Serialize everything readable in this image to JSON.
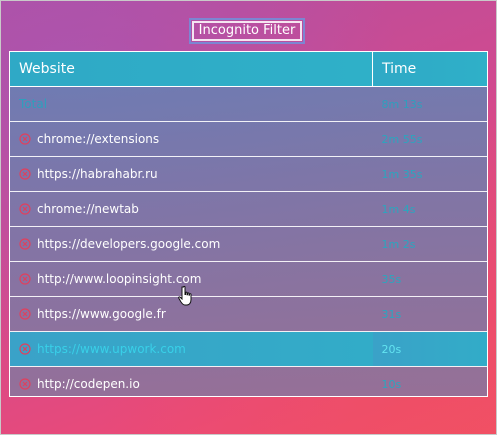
{
  "filter_button": {
    "label": "Incognito Filter"
  },
  "table": {
    "headers": {
      "website": "Website",
      "time": "Time"
    },
    "total": {
      "label": "Total",
      "time": "8m 13s"
    },
    "rows": [
      {
        "site": "chrome://extensions",
        "time": "2m 55s"
      },
      {
        "site": "https://habrahabr.ru",
        "time": "1m 35s"
      },
      {
        "site": "chrome://newtab",
        "time": "1m 4s"
      },
      {
        "site": "https://developers.google.com",
        "time": "1m 2s"
      },
      {
        "site": "http://www.loopinsight.com",
        "time": "35s"
      },
      {
        "site": "https://www.google.fr",
        "time": "31s"
      },
      {
        "site": "https://www.upwork.com",
        "time": "20s"
      },
      {
        "site": "http://codepen.io",
        "time": "10s"
      }
    ],
    "highlighted_row_index": 6
  },
  "colors": {
    "header_bg": "#2fa9c6",
    "remove_icon": "#e0405e",
    "time_text": "#2ba6bf"
  },
  "icons": {
    "remove": "remove-circle-x-icon",
    "cursor": "hand-pointer-icon"
  }
}
